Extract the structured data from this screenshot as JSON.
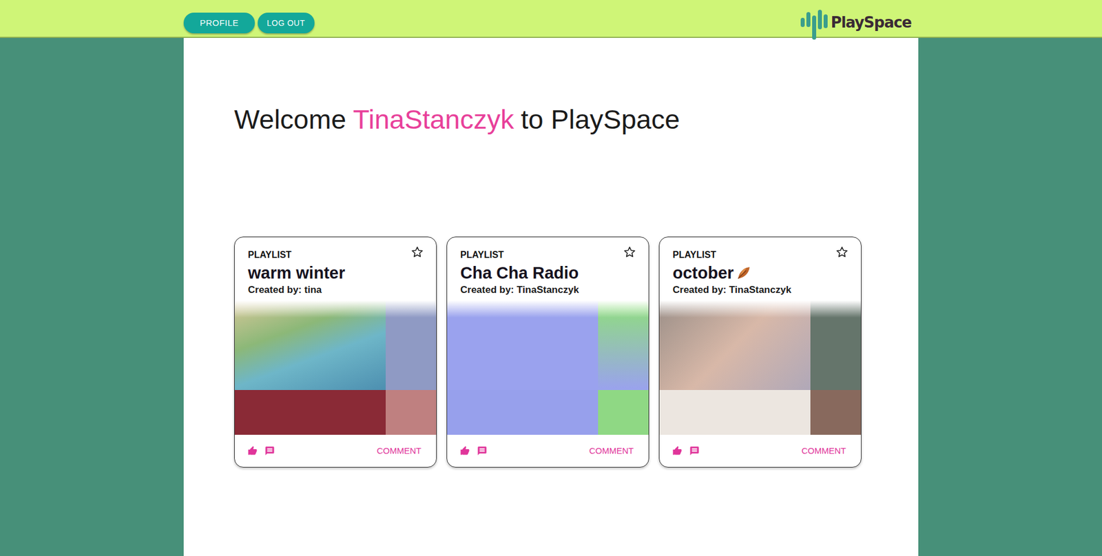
{
  "header": {
    "buttons": [
      {
        "label": "PROFILE"
      },
      {
        "label": "LOG OUT"
      }
    ],
    "logo": "PlaySpace"
  },
  "welcome": {
    "prefix": "Welcome",
    "username": "TinaStanczyk",
    "suffix": "to PlaySpace"
  },
  "cards": [
    {
      "type": "PLAYLIST",
      "title": "warm winter",
      "creator": "Created by: tina",
      "leaf": false,
      "starred": false,
      "action": "COMMENT"
    },
    {
      "type": "PLAYLIST",
      "title": "Cha Cha Radio",
      "creator": "Created by: TinaStanczyk",
      "leaf": false,
      "starred": false,
      "action": "COMMENT"
    },
    {
      "type": "PLAYLIST",
      "title": "october",
      "creator": "Created by: TinaStanczyk",
      "leaf": true,
      "starred": false,
      "action": "COMMENT"
    }
  ]
}
